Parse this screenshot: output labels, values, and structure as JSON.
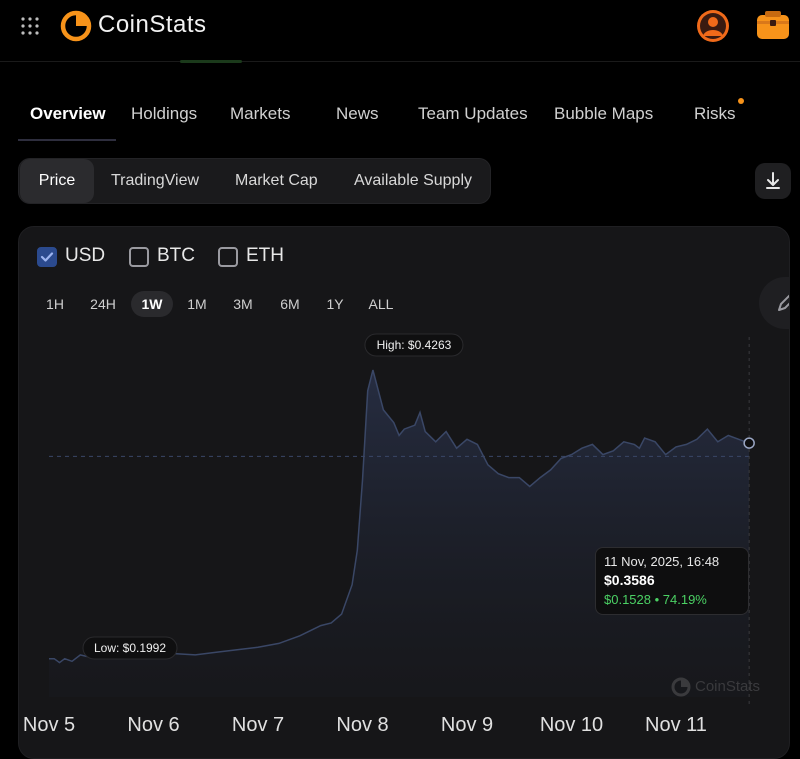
{
  "app": {
    "brand": "CoinStats"
  },
  "icons": {
    "apps": "apps-grid-icon",
    "logo": "coinstats-logo-icon",
    "user": "user-avatar-icon",
    "wallet": "wallet-icon",
    "download": "download-icon",
    "edit": "pencil-icon"
  },
  "colors": {
    "accent_orange": "#f7931a",
    "checkbox_blue": "#2b4a8e",
    "positive_green": "#4bd164",
    "chart_line": "#3a4766",
    "background": "#000000"
  },
  "tabs": [
    {
      "label": "Overview",
      "active": true
    },
    {
      "label": "Holdings"
    },
    {
      "label": "Markets"
    },
    {
      "label": "News"
    },
    {
      "label": "Team Updates"
    },
    {
      "label": "Bubble Maps"
    },
    {
      "label": "Risks",
      "badge": true
    }
  ],
  "chart_tabs": [
    {
      "label": "Price",
      "active": true
    },
    {
      "label": "TradingView"
    },
    {
      "label": "Market Cap"
    },
    {
      "label": "Available Supply"
    }
  ],
  "currencies": [
    {
      "label": "USD",
      "checked": true
    },
    {
      "label": "BTC",
      "checked": false
    },
    {
      "label": "ETH",
      "checked": false
    }
  ],
  "ranges": [
    "1H",
    "24H",
    "1W",
    "1M",
    "3M",
    "6M",
    "1Y",
    "ALL"
  ],
  "selected_range": "1W",
  "tooltip": {
    "date": "11 Nov, 2025, 16:48",
    "price": "$0.3586",
    "change": "$0.1528 • 74.19%"
  },
  "watermark": "CoinStats",
  "chart_data": {
    "type": "area",
    "x_labels": [
      "Nov 5",
      "Nov 6",
      "Nov 7",
      "Nov 8",
      "Nov 9",
      "Nov 10",
      "Nov 11"
    ],
    "x": [
      0,
      0.05,
      0.1,
      0.15,
      0.22,
      0.3,
      0.4,
      0.5,
      0.6,
      0.75,
      0.9,
      1.0,
      1.2,
      1.4,
      1.6,
      1.8,
      2.0,
      2.2,
      2.4,
      2.5,
      2.6,
      2.7,
      2.8,
      2.9,
      2.95,
      3.0,
      3.05,
      3.1,
      3.2,
      3.3,
      3.35,
      3.4,
      3.5,
      3.55,
      3.6,
      3.7,
      3.8,
      3.9,
      4.0,
      4.1,
      4.2,
      4.3,
      4.4,
      4.5,
      4.6,
      4.7,
      4.8,
      4.9,
      5.0,
      5.1,
      5.2,
      5.3,
      5.4,
      5.5,
      5.6,
      5.65,
      5.7,
      5.8,
      5.9,
      6.0,
      6.1,
      6.2,
      6.3,
      6.4,
      6.5,
      6.6,
      6.7
    ],
    "values": [
      0.2,
      0.2,
      0.197,
      0.2,
      0.198,
      0.203,
      0.201,
      0.202,
      0.201,
      0.201,
      0.202,
      0.203,
      0.204,
      0.203,
      0.205,
      0.207,
      0.209,
      0.212,
      0.218,
      0.222,
      0.226,
      0.228,
      0.235,
      0.258,
      0.285,
      0.34,
      0.41,
      0.4263,
      0.395,
      0.385,
      0.375,
      0.38,
      0.383,
      0.393,
      0.378,
      0.37,
      0.378,
      0.365,
      0.372,
      0.368,
      0.352,
      0.345,
      0.342,
      0.342,
      0.335,
      0.342,
      0.348,
      0.357,
      0.36,
      0.365,
      0.368,
      0.36,
      0.363,
      0.37,
      0.368,
      0.365,
      0.373,
      0.37,
      0.36,
      0.366,
      0.368,
      0.372,
      0.38,
      0.37,
      0.375,
      0.372,
      0.369
    ],
    "high": {
      "label": "High: $0.4263",
      "value": 0.4263
    },
    "low": {
      "label": "Low: $0.1992",
      "value": 0.1992
    },
    "reference_line": 0.3586,
    "ylim": [
      0.17,
      0.46
    ],
    "grid": false,
    "legend": "none"
  }
}
